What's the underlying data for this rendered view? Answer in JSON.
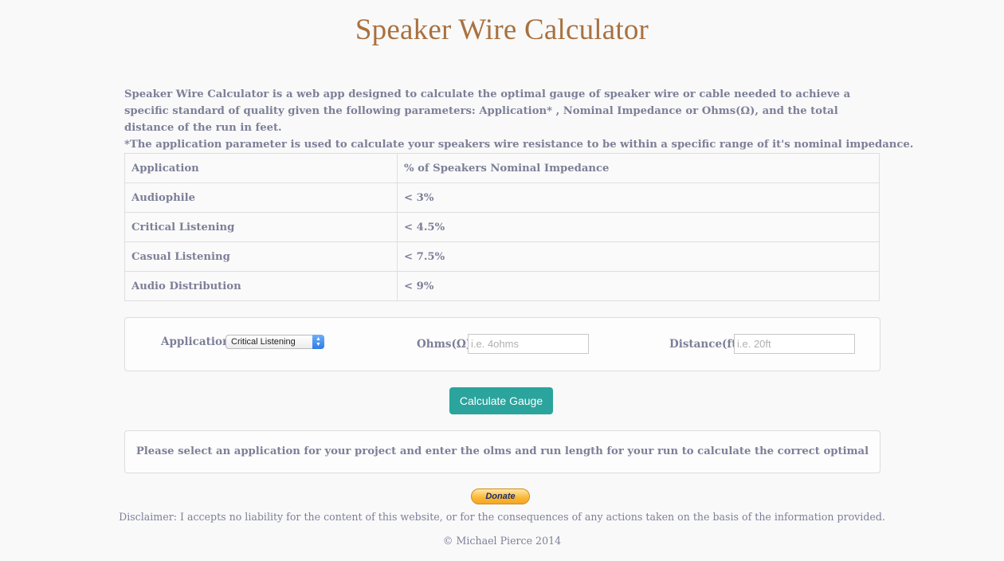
{
  "title": "Speaker Wire Calculator",
  "intro": "Speaker Wire Calculator is a web app designed to calculate the optimal gauge of speaker wire or cable needed to achieve a specific standard of quality given the following parameters: Application* , Nominal Impedance or Ohms(Ω), and the total distance of the run in feet.",
  "note": "*The application parameter is used to calculate your speakers wire resistance to be within a specific range of it's nominal impedance.",
  "table": {
    "headers": [
      "Application",
      "% of Speakers Nominal Impedance"
    ],
    "rows": [
      [
        "Audiophile",
        "< 3%"
      ],
      [
        "Critical Listening",
        "< 4.5%"
      ],
      [
        "Casual Listening",
        "< 7.5%"
      ],
      [
        "Audio Distribution",
        "< 9%"
      ]
    ]
  },
  "form": {
    "application_label": "Application",
    "application_selected": "Critical Listening",
    "ohms_label": "Ohms(Ω)",
    "ohms_placeholder": "i.e. 4ohms",
    "distance_label": "Distance(ft)",
    "distance_placeholder": "i.e. 20ft"
  },
  "calculate_button": "Calculate Gauge",
  "result_message": "Please select an application for your project and enter the olms and run length for your run to calculate the correct optimal gauge.",
  "donate_label": "Donate",
  "disclaimer": "Disclaimer: I accepts no liability for the content of this website, or for the consequences of any actions taken on the basis of the information provided.",
  "copyright": "© Michael Pierce 2014",
  "colors": {
    "title": "#a9713f",
    "text": "#7d7f98",
    "button": "#2aa49d",
    "select_arrow": "#2f7ce9",
    "donate": "#fbb734"
  }
}
